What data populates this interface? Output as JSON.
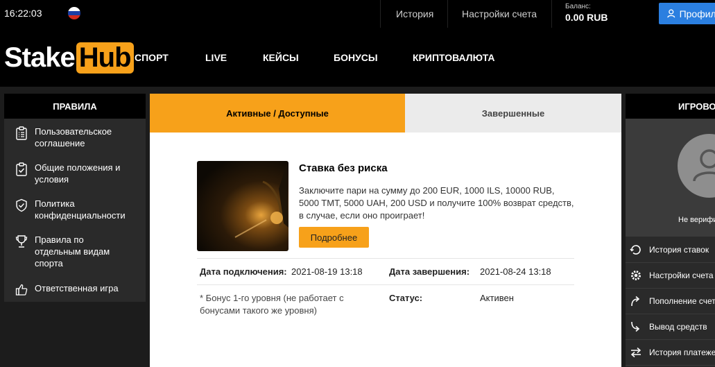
{
  "topbar": {
    "time": "16:22:03",
    "flag_icon": "russia-flag-icon",
    "history": "История",
    "account_settings": "Настройки счета",
    "balance_label": "Баланс:",
    "balance_value": "0.00 RUB",
    "profile_button": "Профиль"
  },
  "brand": {
    "logo_part1": "Stake",
    "logo_part2": "Hub",
    "accent": "#f7a11a"
  },
  "nav": {
    "items": [
      "СПОРТ",
      "LIVE",
      "КЕЙСЫ",
      "БОНУСЫ",
      "КРИПТОВАЛЮТА"
    ]
  },
  "rules": {
    "title": "ПРАВИЛА",
    "items": [
      {
        "label": "Пользовательское соглашение",
        "icon": "clipboard-icon"
      },
      {
        "label": "Общие положения и условия",
        "icon": "clipboard-check-icon"
      },
      {
        "label": "Политика конфиденциальности",
        "icon": "shield-icon"
      },
      {
        "label": "Правила по отдельным видам спорта",
        "icon": "trophy-icon"
      },
      {
        "label": "Ответственная игра",
        "icon": "thumbs-up-icon"
      }
    ]
  },
  "tabs": {
    "active": "Активные / Доступные",
    "completed": "Завершенные"
  },
  "bonus": {
    "title": "Ставка без риска",
    "description": "Заключите пари на сумму до 200 EUR, 1000 ILS, 10000 RUB, 5000 TMT, 5000 UAH, 200 USD и получите 100% возврат средств, в случае, если оно проиграет!",
    "more_button": "Подробнее",
    "connect_label": "Дата подключения:",
    "connect_value": "2021-08-19 13:18",
    "end_label": "Дата завершения:",
    "end_value": "2021-08-24 13:18",
    "note": "* Бонус 1-го уровня (не работает с бонусами такого же уровня)",
    "status_label": "Статус:",
    "status_value": "Активен"
  },
  "account": {
    "title": "ИГРОВОЙ СЧЕТ",
    "not_verified": "Не верифицирован",
    "items": [
      {
        "label": "История ставок",
        "icon": "history-icon"
      },
      {
        "label": "Настройки счета",
        "icon": "gear-icon"
      },
      {
        "label": "Пополнение счета",
        "icon": "deposit-arrow-icon"
      },
      {
        "label": "Вывод средств",
        "icon": "withdraw-arrow-icon"
      },
      {
        "label": "История платежей",
        "icon": "transfer-arrows-icon"
      }
    ]
  }
}
